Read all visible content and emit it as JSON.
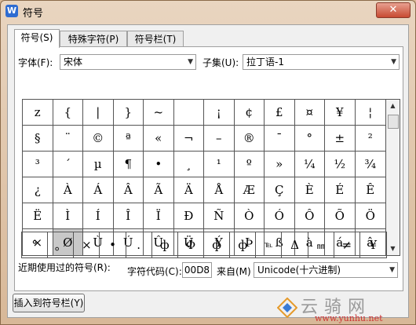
{
  "window": {
    "title": "符号",
    "app_icon": "W",
    "close_glyph": "✕"
  },
  "tabs": [
    "符号(S)",
    "特殊字符(P)",
    "符号栏(T)"
  ],
  "font": {
    "label": "字体(F):",
    "value": "宋体"
  },
  "subset": {
    "label": "子集(U):",
    "value": "拉丁语-1"
  },
  "symbols": [
    "z",
    "{",
    "|",
    "}",
    "~",
    " ",
    "¡",
    "¢",
    "£",
    "¤",
    "¥",
    "¦",
    "§",
    "¨",
    "©",
    "ª",
    "«",
    "¬",
    "–",
    "®",
    "¯",
    "°",
    "±",
    "²",
    "³",
    "´",
    "µ",
    "¶",
    "•",
    "¸",
    "¹",
    "º",
    "»",
    "¼",
    "½",
    "¾",
    "¿",
    "À",
    "Á",
    "Â",
    "Ã",
    "Ä",
    "Å",
    "Æ",
    "Ç",
    "È",
    "É",
    "Ê",
    "Ë",
    "Ì",
    "Í",
    "Î",
    "Ï",
    "Ð",
    "Ñ",
    "Ò",
    "Ó",
    "Ô",
    "Õ",
    "Ö",
    "×",
    "Ø",
    "Ù",
    "Ú",
    "Û",
    "Ü",
    "Ý",
    "Þ",
    "ß",
    "à",
    "á",
    "â"
  ],
  "selected_symbol": "Ø",
  "recent": {
    "label": "近期使用过的符号(R):",
    "items": [
      "°",
      "。",
      "×",
      "•",
      ".",
      "ф",
      "Ф",
      "ф",
      "ф",
      "℡",
      "Δ",
      "㎜",
      "≠",
      "¥"
    ]
  },
  "char_code": {
    "label": "字符代码(C):",
    "value": "00D8"
  },
  "from": {
    "label": "来自(M)",
    "value": "Unicode(十六进制)"
  },
  "insert_button": "插入到符号栏(Y)",
  "watermark": {
    "cn": "云骑网",
    "url": "www.yunhu.net"
  },
  "colors": {
    "close": "#c74a32",
    "selected_cell": "#c8c8c8",
    "app_icon": "#2e6cd1"
  }
}
